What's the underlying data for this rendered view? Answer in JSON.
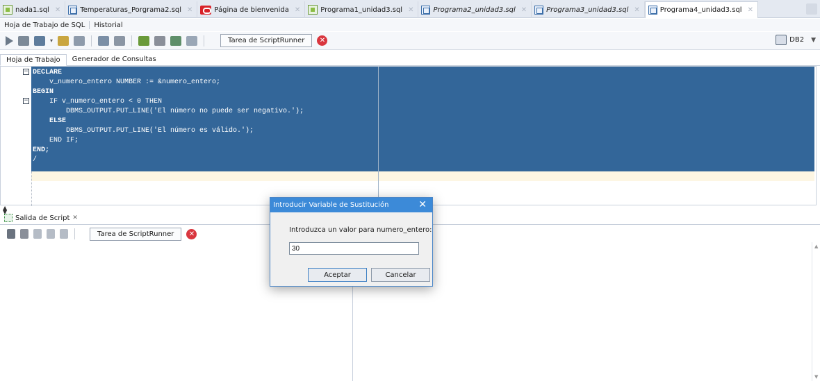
{
  "tabs": [
    {
      "label": "nada1.sql",
      "icon": "sql-worksheet-icon",
      "italic": false,
      "active": false
    },
    {
      "label": "Temperaturas_Porgrama2.sql",
      "icon": "document-icon",
      "italic": false,
      "active": false
    },
    {
      "label": "Página de bienvenida",
      "icon": "oracle-icon",
      "italic": false,
      "active": false
    },
    {
      "label": "Programa1_unidad3.sql",
      "icon": "sql-worksheet-icon",
      "italic": false,
      "active": false
    },
    {
      "label": "Programa2_unidad3.sql",
      "icon": "document-icon",
      "italic": true,
      "active": false
    },
    {
      "label": "Programa3_unidad3.sql",
      "icon": "document-icon",
      "italic": true,
      "active": false
    },
    {
      "label": "Programa4_unidad3.sql",
      "icon": "document-icon",
      "italic": false,
      "active": true
    }
  ],
  "subbar": {
    "worksheet": "Hoja de Trabajo de SQL",
    "history": "Historial"
  },
  "toolbar": {
    "task_button": "Tarea de ScriptRunner",
    "connection": "DB2"
  },
  "editor_tabs": {
    "worksheet": "Hoja de Trabajo",
    "query_builder": "Generador de Consultas"
  },
  "code_lines": [
    "DECLARE",
    "    v_numero_entero NUMBER := &numero_entero;",
    "BEGIN",
    "    IF v_numero_entero < 0 THEN",
    "        DBMS_OUTPUT.PUT_LINE('El número no puede ser negativo.');",
    "    ELSE",
    "        DBMS_OUTPUT.PUT_LINE('El número es válido.');",
    "    END IF;",
    "END;",
    "/"
  ],
  "output": {
    "tab_label": "Salida de Script",
    "task_button": "Tarea de ScriptRunner"
  },
  "dialog": {
    "title": "Introducir Variable de Sustitución",
    "prompt": "Introduzca un valor para numero_entero:",
    "value": "30",
    "ok_label": "Aceptar",
    "cancel_label": "Cancelar"
  },
  "colors": {
    "selection": "#336699",
    "dialog_title": "#3c8ad8",
    "stop": "#d9363e"
  }
}
